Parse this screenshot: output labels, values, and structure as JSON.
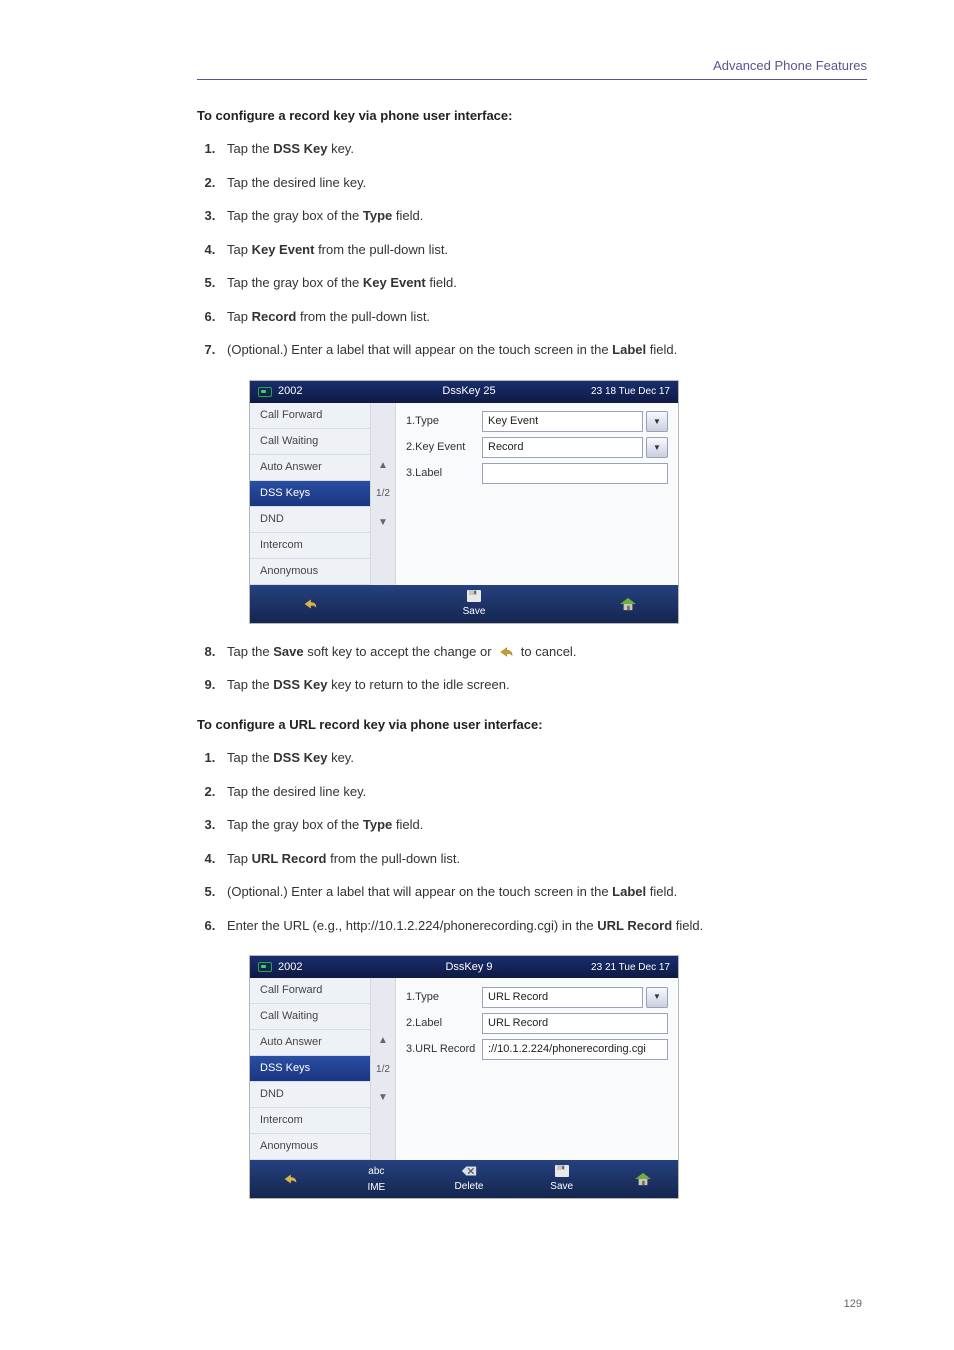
{
  "header": {
    "section_title": "Advanced Phone Features"
  },
  "section1_title": "To configure a record key via phone user interface:",
  "steps1": {
    "s1": "Tap the ",
    "s1b": "DSS Key",
    "s1c": " key.",
    "s2": "Tap the desired line key.",
    "s3": "Tap the gray box of the ",
    "s3b": "Type",
    "s3c": " field.",
    "s4": "Tap ",
    "s4b": "Key Event",
    "s4c": " from the pull-down list.",
    "s5": "Tap the gray box of the ",
    "s5b": "Key Event",
    "s5c": " field.",
    "s6": "Tap ",
    "s6b": "Record",
    "s6c": " from the pull-down list.",
    "s7": "(Optional.) Enter a label that will appear on the touch screen in the ",
    "s7b": "Label",
    "s7c": " field.",
    "s8": "Tap the ",
    "s8b": "Save",
    "s8c": " soft key to accept the change or ",
    "s8d": " to cancel.",
    "s9": "Tap the ",
    "s9b": "DSS Key",
    "s9c": " key to return to the idle screen."
  },
  "section2_title": "To configure a URL record key via phone user interface:",
  "steps2": {
    "s1": "Tap the ",
    "s1b": "DSS Key",
    "s1c": " key.",
    "s2": "Tap the desired line key.",
    "s3": "Tap the gray box of the ",
    "s3b": "Type",
    "s3c": " field.",
    "s4": "Tap ",
    "s4b": "URL Record",
    "s4c": " from the pull-down list.",
    "s5": "(Optional.) Enter a label that will appear on the touch screen in the ",
    "s5b": "Label",
    "s5c": " field.",
    "s6": "Enter the URL (e.g., http://10.1.2.224/phonerecording.cgi) in the ",
    "s6b": "URL Record",
    "s6c": " field."
  },
  "phone1": {
    "account": "2002",
    "title": "DssKey 25",
    "clock": "23 18 Tue Dec 17",
    "menu": [
      "Call Forward",
      "Call Waiting",
      "Auto Answer",
      "DSS Keys",
      "DND",
      "Intercom",
      "Anonymous"
    ],
    "pager": "1/2",
    "rows": {
      "r1_label": "1.Type",
      "r1_value": "Key Event",
      "r2_label": "2.Key Event",
      "r2_value": "Record",
      "r3_label": "3.Label",
      "r3_value": ""
    },
    "softkeys": {
      "save": "Save"
    }
  },
  "phone2": {
    "account": "2002",
    "title": "DssKey 9",
    "clock": "23 21 Tue Dec 17",
    "menu": [
      "Call Forward",
      "Call Waiting",
      "Auto Answer",
      "DSS Keys",
      "DND",
      "Intercom",
      "Anonymous"
    ],
    "pager": "1/2",
    "rows": {
      "r1_label": "1.Type",
      "r1_value": "URL Record",
      "r2_label": "2.Label",
      "r2_value": "URL Record",
      "r3_label": "3.URL Record",
      "r3_value": "://10.1.2.224/phonerecording.cgi"
    },
    "softkeys": {
      "ime": "abc",
      "ime2": "IME",
      "delete": "Delete",
      "save": "Save"
    }
  },
  "page_number": "129"
}
